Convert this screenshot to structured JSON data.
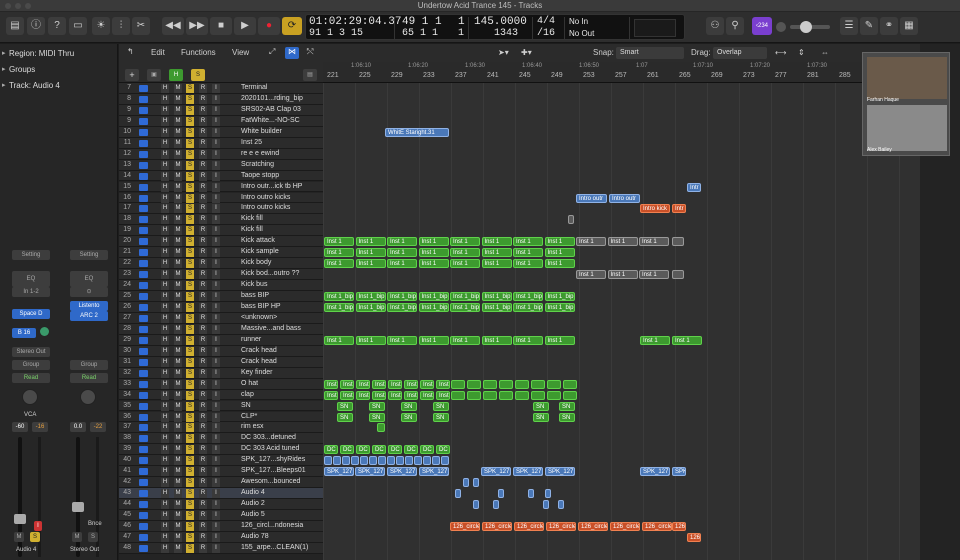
{
  "window": {
    "title": "Undertow Acid Trance 145 - Tracks"
  },
  "lcd": {
    "time": "01:02:29:04.37",
    "bar_top": "49  1  1",
    "bar_tick": "1",
    "tempo": "145.0000",
    "sig": "4/4",
    "in": "No In",
    "bot_time": "91  1  3     15",
    "bot_bar": "65  1  1",
    "bot_tick": "1",
    "bot_tempo": "1343",
    "div": "/16",
    "out": "No Out"
  },
  "toolbar": {
    "badge": "‹234"
  },
  "inspector": {
    "region": "Region: MIDI Thru",
    "groups": "Groups",
    "track": "Track: Audio 4",
    "setting": "Setting",
    "eq": "EQ",
    "in12": "In 1-2",
    "listento": "Listento",
    "arc2": "ARC 2",
    "space_d": "Space D",
    "b16": "B 16",
    "stereo_out": "Stereo Out",
    "group": "Group",
    "read": "Read",
    "vca": "VCA",
    "vol1": "-60",
    "vol1b": "-16",
    "vol2": "0.0",
    "vol2b": "-22",
    "bnce": "Bnce",
    "ch1": "Audio 4",
    "ch2": "Stereo Out",
    "m": "M",
    "s": "S",
    "i": "I"
  },
  "tracks_header": {
    "edit": "Edit",
    "functions": "Functions",
    "view": "View",
    "snap_label": "Snap:",
    "snap": "Smart",
    "drag_label": "Drag:",
    "drag": "Overlap"
  },
  "ruler": {
    "bars": [
      "221",
      "225",
      "229",
      "233",
      "237",
      "241",
      "245",
      "249",
      "253",
      "257",
      "261",
      "265",
      "269",
      "273",
      "277",
      "281",
      "285"
    ],
    "times": [
      "1:06:10",
      "1:06:20",
      "1:06:30",
      "1:06:40",
      "1:06:50",
      "1:07",
      "1:07:10",
      "1:07:20",
      "1:07:30",
      "1:07:40",
      "1:07:50"
    ]
  },
  "tracks": [
    {
      "n": "7",
      "name": "Terminal"
    },
    {
      "n": "8",
      "name": "2020101...rding_bip"
    },
    {
      "n": "9",
      "name": "SRS02-AB Clap 03"
    },
    {
      "n": "9",
      "name": "FatWhite...-NO-SC"
    },
    {
      "n": "10",
      "name": "White builder"
    },
    {
      "n": "11",
      "name": "Inst 25"
    },
    {
      "n": "12",
      "name": "re e e ewind"
    },
    {
      "n": "13",
      "name": "Scratching"
    },
    {
      "n": "14",
      "name": "Taope stopp"
    },
    {
      "n": "15",
      "name": "Intro outr...ick tb HP"
    },
    {
      "n": "16",
      "name": "Intro outro kicks"
    },
    {
      "n": "17",
      "name": "Intro outro kicks"
    },
    {
      "n": "18",
      "name": "Kick fill"
    },
    {
      "n": "19",
      "name": "Kick fill"
    },
    {
      "n": "20",
      "name": "Kick attack"
    },
    {
      "n": "21",
      "name": "Kick sample"
    },
    {
      "n": "22",
      "name": "Kick body"
    },
    {
      "n": "23",
      "name": "Kick bod...outro ??"
    },
    {
      "n": "24",
      "name": "Kick bus"
    },
    {
      "n": "25",
      "name": "bass BIP"
    },
    {
      "n": "26",
      "name": "bass BIP HP"
    },
    {
      "n": "27",
      "name": "<unknown>"
    },
    {
      "n": "28",
      "name": "Massive...and bass"
    },
    {
      "n": "29",
      "name": "runner"
    },
    {
      "n": "30",
      "name": "Crack head"
    },
    {
      "n": "31",
      "name": "Crack head"
    },
    {
      "n": "32",
      "name": "Key finder"
    },
    {
      "n": "33",
      "name": "O hat"
    },
    {
      "n": "34",
      "name": "clap"
    },
    {
      "n": "35",
      "name": "SN"
    },
    {
      "n": "36",
      "name": "CLP*"
    },
    {
      "n": "37",
      "name": "rim esx"
    },
    {
      "n": "38",
      "name": "DC 303...detuned"
    },
    {
      "n": "39",
      "name": "DC 303 Acid tuned"
    },
    {
      "n": "40",
      "name": "SPK_127...shyRides"
    },
    {
      "n": "41",
      "name": "SPK_127...Bleeps01"
    },
    {
      "n": "42",
      "name": "Awesom...bounced"
    },
    {
      "n": "43",
      "name": "Audio 4"
    },
    {
      "n": "44",
      "name": "Audio 2"
    },
    {
      "n": "45",
      "name": "Audio 5"
    },
    {
      "n": "46",
      "name": "126_circl...ndonesia"
    },
    {
      "n": "47",
      "name": "Audio 78"
    },
    {
      "n": "48",
      "name": "155_arpe...CLEAN(1)"
    }
  ],
  "buttons": {
    "h": "H",
    "m": "M",
    "s": "S",
    "r": "R",
    "i": "I"
  },
  "regions": {
    "white": "WhitE Staright.31",
    "intro1": "Intro outr",
    "intro2": "Intro outr",
    "intr": "Intr",
    "introkick": "Intro kick",
    "intr2": "Intr",
    "inst1": "Inst 1",
    "inst1bip": "Inst 1_bip",
    "sn": "SN",
    "dc": "DC",
    "spk": "SPK_127_",
    "spk2": "SPK",
    "circle": "126_circle",
    "num126": "126"
  },
  "video": {
    "name1": "Farhan Haque",
    "name2": "Alex Bailey"
  }
}
